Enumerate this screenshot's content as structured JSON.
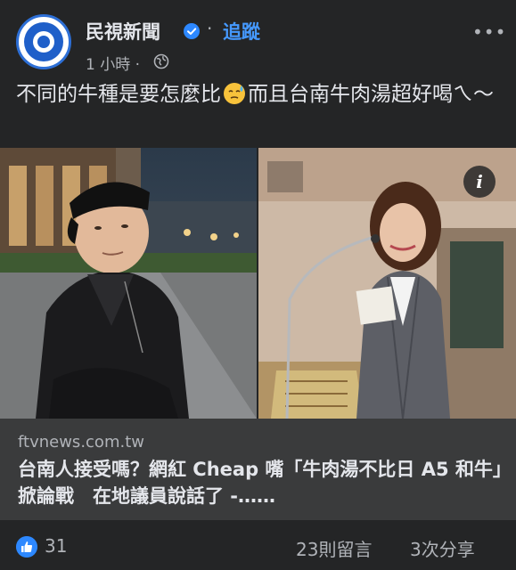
{
  "post": {
    "page_name": "民視新聞",
    "separator": "·",
    "follow_label": "追蹤",
    "more_icon": "more-horizontal-icon",
    "time": "1 小時 ·",
    "privacy_icon": "globe-icon",
    "caption_part1": "不同的牛種是要怎麼比",
    "caption_emoji": "sweat-emoji",
    "caption_part2": "而且台南牛肉湯超好喝ㄟ～"
  },
  "link_preview": {
    "info_label": "i",
    "domain": "ftvnews.com.tw",
    "headline": "台南人接受嗎？網紅 Cheap 嘴「牛肉湯不比日 A5 和牛」掀論戰　在地議員說話了 -……"
  },
  "engagement": {
    "like_icon": "thumbs-up-icon",
    "likes": "31",
    "comments": "23則留言",
    "shares": "3次分享"
  },
  "colors": {
    "background": "#242526",
    "link_box": "#3a3b3c",
    "accent": "#4599ff",
    "like_blue": "#2d88ff",
    "text_primary": "#e4e6eb",
    "text_secondary": "#b0b3b8"
  }
}
